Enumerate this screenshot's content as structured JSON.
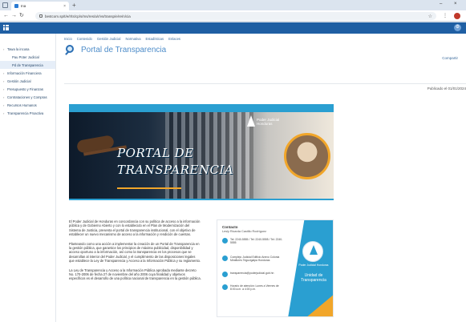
{
  "browser": {
    "tab_title": "Ina",
    "url": "bestcom.sp/t/e/r/ts/cp/s/ms/res/a/r/vs/transp/e/re/n/cia",
    "new_tab_symbol": "+",
    "win_minimize": "–",
    "win_close": "×"
  },
  "left_nav": {
    "items": [
      {
        "label": "Tawa la incusa",
        "active": false,
        "sub": false
      },
      {
        "label": "Pau Poter Judicial",
        "active": false,
        "sub": true
      },
      {
        "label": "Pd de Transparencia",
        "active": true,
        "sub": true
      },
      {
        "label": "Información Financiera",
        "active": false,
        "sub": false
      },
      {
        "label": "Gestión Judicial",
        "active": false,
        "sub": false
      },
      {
        "label": "Presupuesto y Finanzas",
        "active": false,
        "sub": false
      },
      {
        "label": "Contrataciones y Compras",
        "active": false,
        "sub": false
      },
      {
        "label": "Recursos Humanos",
        "active": false,
        "sub": false
      },
      {
        "label": "Transparencia Proactiva",
        "active": false,
        "sub": false
      }
    ]
  },
  "top_nav": [
    "Inicio",
    "Contenido",
    "Gestión Judicial",
    "Normativa",
    "Estadísticas",
    "Enlaces"
  ],
  "page": {
    "title": "Portal de Transparencia",
    "share": "Compartir",
    "published": "Publicado el 01/01/2024"
  },
  "banner": {
    "line1": "PORTAL DE",
    "line2": "TRANSPARENCIA",
    "brand": "Poder Judicial Honduras"
  },
  "body_paragraphs": [
    "El Poder Judicial de Honduras en concordancia con su política de acceso a la información pública y de Gobierno Abierto y con lo establecido en el Plan de Modernización del Sistema de Justicia, presenta el portal de transparencia institucional, con el objetivo de establecer un nuevo mecanismo de acceso a la información y rendición de cuentas.",
    "Planteando como una acción a implementar la creación de un Portal de Transparencia en la gestión pública, que garantice los principios de máxima publicidad, disponibilidad y acceso oportuno a la información, así como la transparencia en los procesos que se desarrollan al interior del Poder Judicial, y el cumplimiento de las disposiciones legales que establece la Ley de Transparencia y Acceso a la Información Pública y su reglamento.",
    "La Ley de Transparencia y Acceso a la Información Pública aprobada mediante decreto No. 170-2006 de fecha 27 de noviembre del año 2006 cuya finalidad y objetivos específicos es el desarrollo de una política nacional de transparencia en la gestión pública."
  ],
  "contact_card": {
    "label": "Contacto",
    "name": "Lesly Ricarda Castillo Rodríguez",
    "phones": "Tel: 2240-5555 / Tel: 2240-5555 / Tel: 2240-5555",
    "address": "Complejo Judicial Edificio Anexo Colonia Miraflores Tegucigalpa Honduras",
    "email": "transparencia@poderjudicial.gob.hn",
    "hours": "Horario de atención: Lunes a Viernes de 8:00 a.m. a 4:00 p.m.",
    "emblem_text": "Poder Judicial Honduras",
    "title": "Unidad de Transparencia"
  }
}
